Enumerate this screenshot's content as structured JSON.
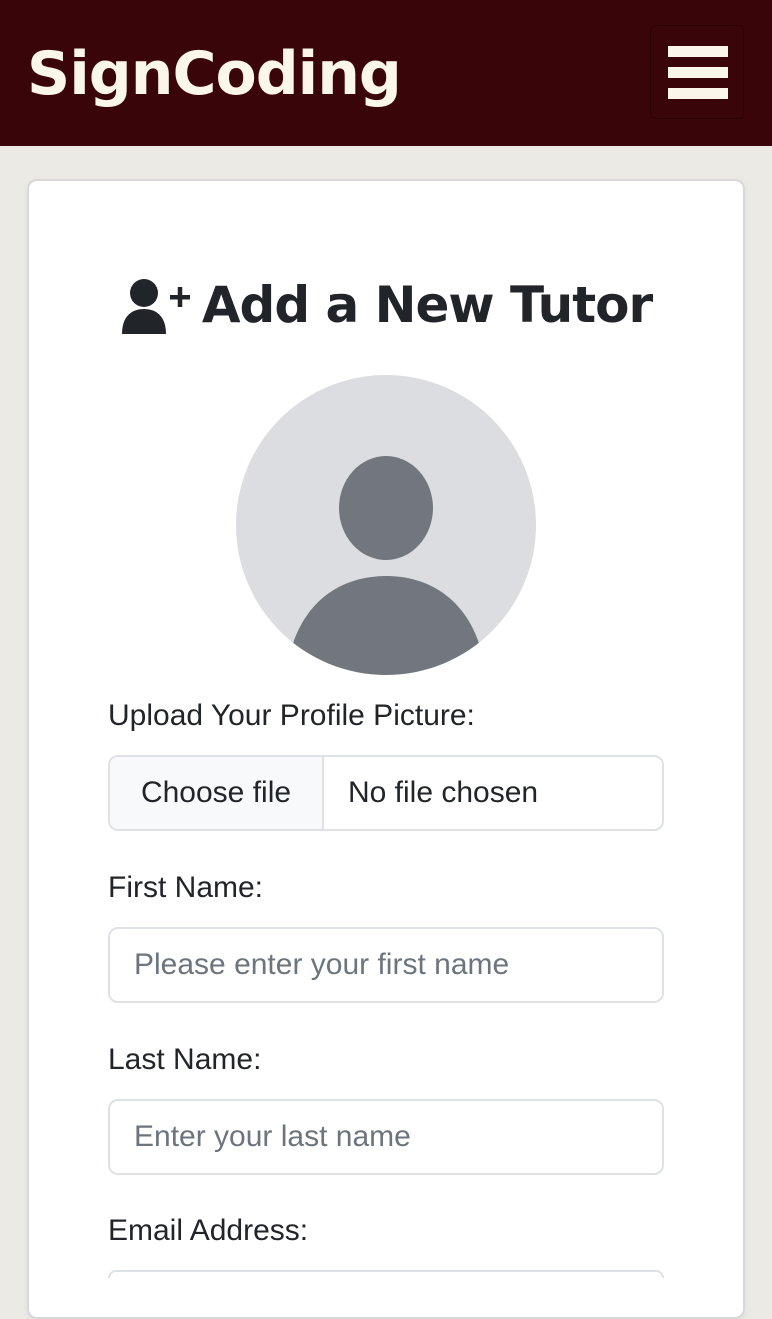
{
  "navbar": {
    "brand": "SignCoding",
    "menu_icon": "hamburger-menu-icon"
  },
  "form": {
    "title": "Add a New Tutor",
    "title_icon": "user-plus-icon",
    "avatar_icon": "default-avatar-icon",
    "upload": {
      "label": "Upload Your Profile Picture:",
      "button_label": "Choose file",
      "status": "No file chosen"
    },
    "first_name": {
      "label": "First Name:",
      "value": "",
      "placeholder": "Please enter your first name"
    },
    "last_name": {
      "label": "Last Name:",
      "value": "",
      "placeholder": "Enter your last name"
    },
    "email": {
      "label": "Email Address:",
      "value": "",
      "placeholder": ""
    }
  },
  "colors": {
    "navbar_bg": "#3a0509",
    "brand_text": "#fbf6ea",
    "page_bg": "#eceae5",
    "avatar_bg": "#dcdde1",
    "avatar_fg": "#72777e"
  }
}
